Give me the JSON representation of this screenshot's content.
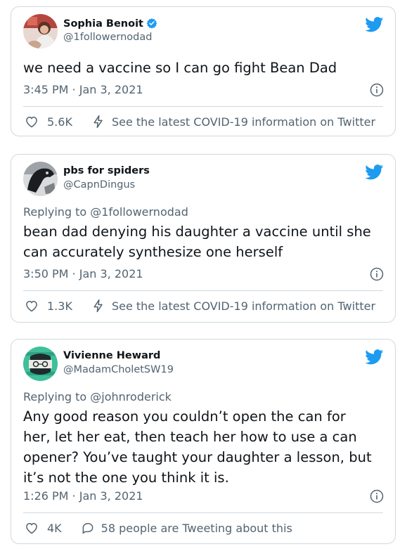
{
  "colors": {
    "twitter_blue": "#1d9bf0",
    "text": "#0f1419",
    "muted": "#536471",
    "border": "#cfd9de"
  },
  "tweets": [
    {
      "name": "Sophia Benoit",
      "verified": true,
      "handle": "@1followernodad",
      "reply_to": "",
      "text": "we need a vaccine so I can go fight Bean Dad",
      "timestamp": "3:45 PM · Jan 3, 2021",
      "likes": "5.6K",
      "footer_link": "See the latest COVID-19 information on Twitter",
      "icons": [
        "twitter-bird-icon",
        "info-icon",
        "heart-icon",
        "lightning-icon"
      ]
    },
    {
      "name": "pbs for spiders",
      "verified": false,
      "handle": "@CapnDingus",
      "reply_to": "Replying to @1followernodad",
      "text": "bean dad denying his daughter a vaccine until she\ncan accurately synthesize one herself",
      "timestamp": "3:50 PM · Jan 3, 2021",
      "likes": "1.3K",
      "footer_link": "See the latest COVID-19 information on Twitter",
      "icons": [
        "twitter-bird-icon",
        "info-icon",
        "heart-icon",
        "lightning-icon"
      ]
    },
    {
      "name": "Vivienne Heward",
      "verified": false,
      "handle": "@MadamCholetSW19",
      "reply_to": "Replying to @johnroderick",
      "text": "Any good reason you couldn’t open the can for\nher, let her eat, then teach her how to use a can\nopener? You’ve taught your daughter a lesson, but\nit’s not the one you think it is.",
      "timestamp": "1:26 PM · Jan 3, 2021",
      "likes": "4K",
      "footer_link": "58 people are Tweeting about this",
      "icons": [
        "twitter-bird-icon",
        "info-icon",
        "heart-icon",
        "speech-bubble-icon"
      ]
    }
  ]
}
